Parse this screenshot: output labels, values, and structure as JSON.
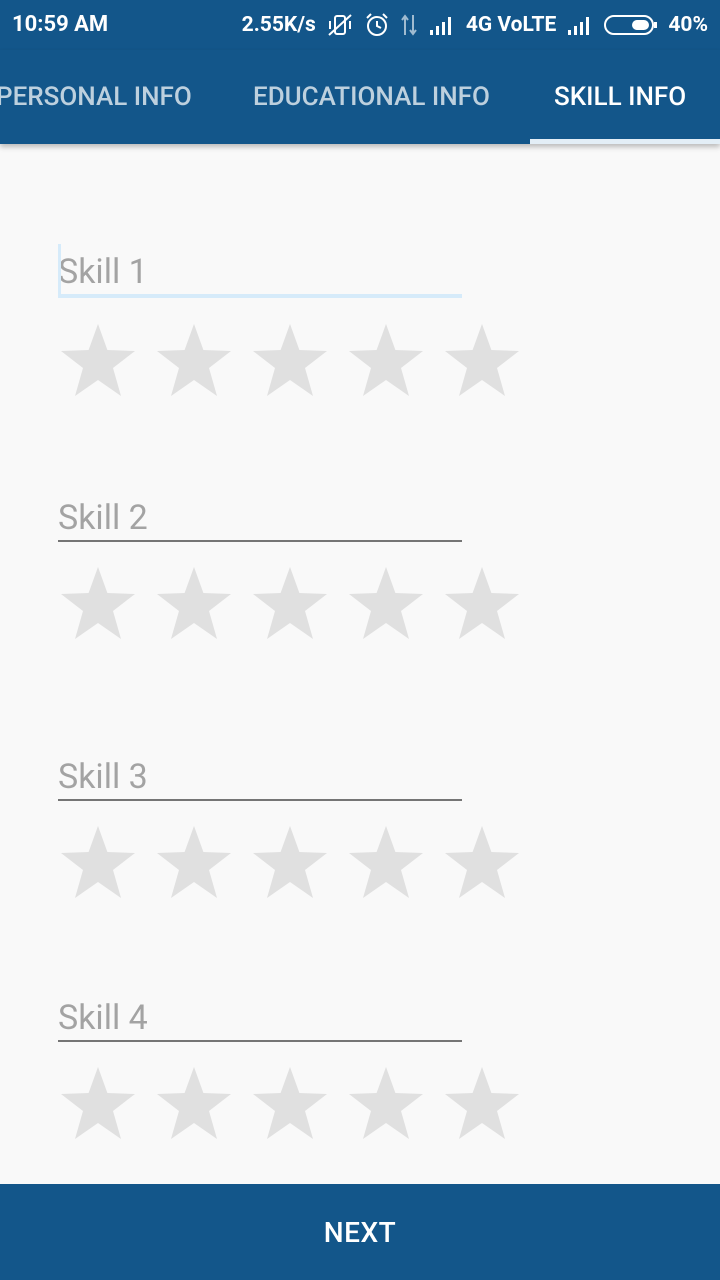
{
  "status_bar": {
    "time": "10:59 AM",
    "speed": "2.55K/s",
    "network": "4G VoLTE",
    "battery": "40%",
    "icons": [
      "vibrate-off-icon",
      "alarm-icon",
      "data-arrows-icon",
      "signal-icon",
      "signal-icon",
      "battery-icon"
    ]
  },
  "tabs": [
    {
      "label": "PERSONAL INFO"
    },
    {
      "label": "EDUCATIONAL INFO"
    },
    {
      "label": "SKILL INFO"
    }
  ],
  "active_tab": "SKILL INFO",
  "skills": [
    {
      "placeholder": "Skill 1",
      "value": "",
      "rating": 0,
      "max_rating": 5
    },
    {
      "placeholder": "Skill 2",
      "value": "",
      "rating": 0,
      "max_rating": 5
    },
    {
      "placeholder": "Skill 3",
      "value": "",
      "rating": 0,
      "max_rating": 5
    },
    {
      "placeholder": "Skill 4",
      "value": "",
      "rating": 0,
      "max_rating": 5
    }
  ],
  "next_button": {
    "label": "NEXT"
  },
  "colors": {
    "primary": "#13568a",
    "star_empty": "#e0e0e0",
    "focus": "#d6ebfa",
    "background": "#f9f9f9"
  }
}
